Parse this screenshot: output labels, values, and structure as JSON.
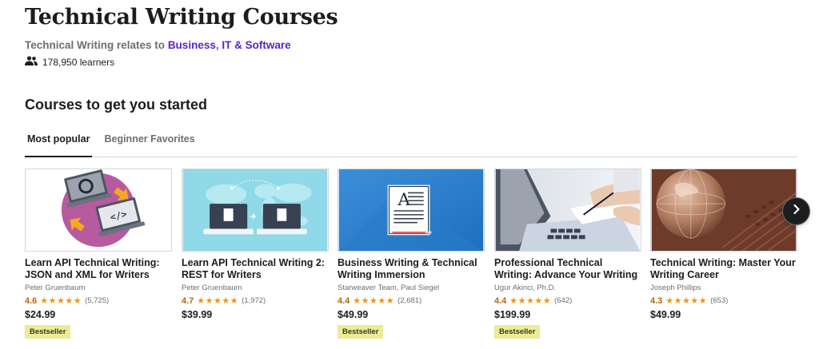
{
  "page": {
    "title": "Technical Writing Courses",
    "relates_prefix": "Technical Writing relates to",
    "relates_link_1": "Business",
    "relates_sep": ", ",
    "relates_link_2": "IT & Software",
    "learners": "178,950 learners"
  },
  "section": {
    "title": "Courses to get you started",
    "tabs": [
      {
        "label": "Most popular",
        "active": true
      },
      {
        "label": "Beginner Favorites",
        "active": false
      }
    ]
  },
  "courses": [
    {
      "title": "Learn API Technical Writing: JSON and XML for Writers",
      "author": "Peter Gruenbaum",
      "rating": "4.6",
      "stars": "★★★★★",
      "count": "(5,725)",
      "price": "$24.99",
      "badge": "Bestseller",
      "thumb_icon": "laptops-code-icon"
    },
    {
      "title": "Learn API Technical Writing 2: REST for Writers",
      "author": "Peter Gruenbaum",
      "rating": "4.7",
      "stars": "★★★★★",
      "count": "(1,972)",
      "price": "$39.99",
      "badge": "",
      "thumb_icon": "world-map-laptops-icon"
    },
    {
      "title": "Business Writing & Technical Writing Immersion",
      "author": "Starweaver Team, Paul Siegel",
      "rating": "4.4",
      "stars": "★★★★★",
      "count": "(2,681)",
      "price": "$49.99",
      "badge": "Bestseller",
      "thumb_icon": "document-icon"
    },
    {
      "title": "Professional Technical Writing: Advance Your Writing Skills",
      "author": "Ugur Akinci, Ph.D.",
      "rating": "4.4",
      "stars": "★★★★★",
      "count": "(642)",
      "price": "$199.99",
      "badge": "Bestseller",
      "thumb_icon": "laptop-hands-photo"
    },
    {
      "title": "Technical Writing: Master Your Writing Career",
      "author": "Joseph Phillips",
      "rating": "4.3",
      "stars": "★★★★★",
      "count": "(653)",
      "price": "$49.99",
      "badge": "",
      "thumb_icon": "globe-keyboard-photo"
    }
  ],
  "colors": {
    "link": "#5624d0",
    "rating": "#b4690e",
    "star": "#e59819",
    "badge_bg": "#eceb98"
  },
  "icons": {
    "learners": "people-icon",
    "next": "chevron-right-icon"
  }
}
